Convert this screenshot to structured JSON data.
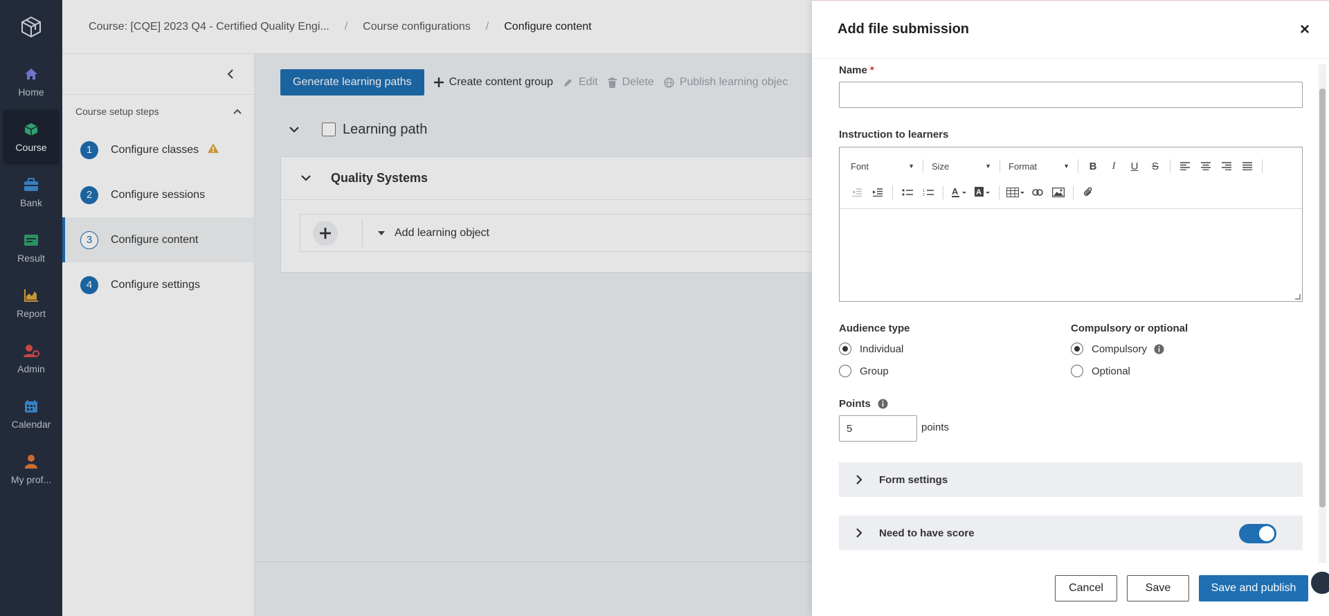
{
  "nav": {
    "items": [
      {
        "label": "Home",
        "icon": "home-icon",
        "color": "#7b83e0"
      },
      {
        "label": "Course",
        "icon": "cube-icon",
        "color": "#35b37e",
        "active": true
      },
      {
        "label": "Bank",
        "icon": "briefcase-icon",
        "color": "#3d8fd6"
      },
      {
        "label": "Result",
        "icon": "card-icon",
        "color": "#2fa36b"
      },
      {
        "label": "Report",
        "icon": "chart-icon",
        "color": "#e0a63a"
      },
      {
        "label": "Admin",
        "icon": "user-gear-icon",
        "color": "#e0504a"
      },
      {
        "label": "Calendar",
        "icon": "calendar-icon",
        "color": "#3d8fd6"
      },
      {
        "label": "My prof...",
        "icon": "user-icon",
        "color": "#e07a3a"
      }
    ]
  },
  "breadcrumb": {
    "course": "Course: [CQE] 2023 Q4 - Certified Quality Engi...",
    "configs": "Course configurations",
    "current": "Configure content",
    "sep": "/"
  },
  "steps": {
    "header": "Course setup steps",
    "items": [
      {
        "num": "1",
        "label": "Configure classes",
        "warning": true
      },
      {
        "num": "2",
        "label": "Configure sessions"
      },
      {
        "num": "3",
        "label": "Configure content",
        "active": true
      },
      {
        "num": "4",
        "label": "Configure settings"
      }
    ]
  },
  "toolbar": {
    "generate": "Generate learning paths",
    "create_group": "Create content group",
    "edit": "Edit",
    "delete": "Delete",
    "publish": "Publish learning objec"
  },
  "content": {
    "learning_path": "Learning path",
    "group_title": "Quality Systems",
    "add_lo": "Add learning object"
  },
  "drawer": {
    "title": "Add file submission",
    "close": "×",
    "name_label": "Name",
    "required_mark": "*",
    "instruction_label": "Instruction to learners",
    "editor": {
      "font": "Font",
      "size": "Size",
      "format": "Format"
    },
    "audience_label": "Audience type",
    "audience_options": [
      "Individual",
      "Group"
    ],
    "compulsory_label": "Compulsory or optional",
    "compulsory_options": [
      "Compulsory",
      "Optional"
    ],
    "points_label": "Points",
    "points_value": "5",
    "points_unit": "points",
    "form_settings": "Form settings",
    "need_score": "Need to have score",
    "need_score_on": true,
    "buttons": {
      "cancel": "Cancel",
      "save": "Save",
      "save_publish": "Save and publish"
    }
  },
  "colors": {
    "accent": "#1f6fb2",
    "nav_bg": "#283041",
    "warning": "#e0a63a",
    "required": "#d0342c"
  }
}
